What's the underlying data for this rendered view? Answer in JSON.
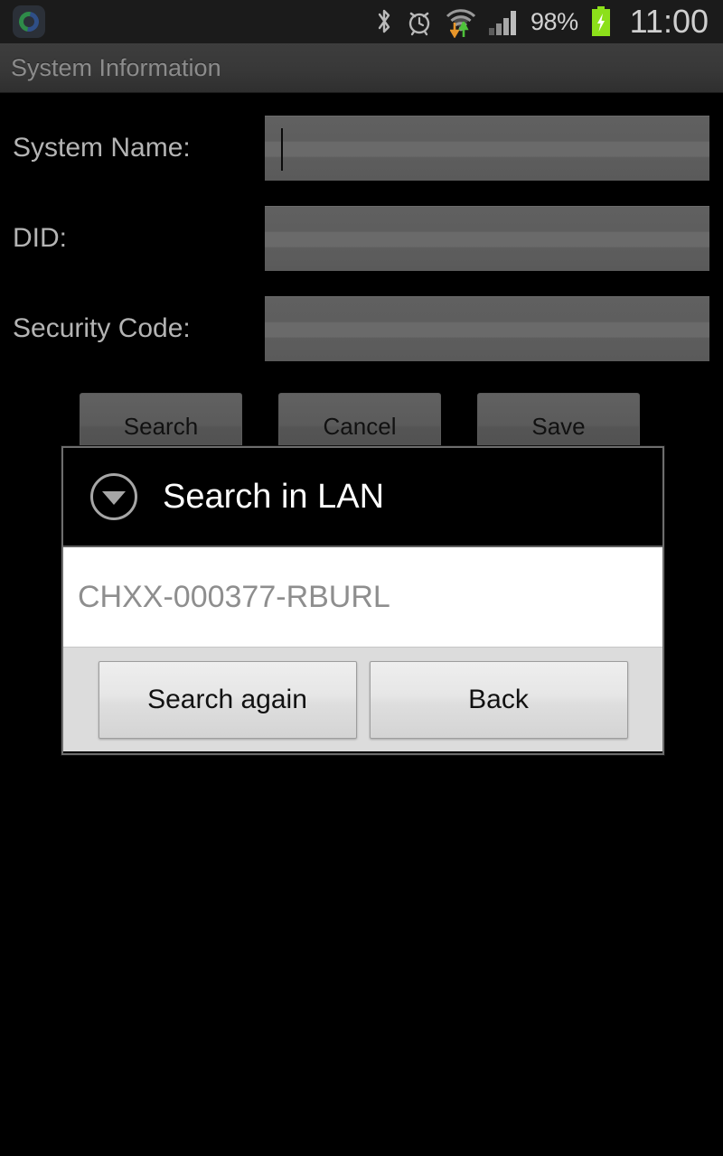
{
  "status_bar": {
    "app_icon": "app-launcher-icon",
    "icons": [
      "bluetooth-icon",
      "alarm-clock-icon",
      "wifi-icon",
      "data-transfer-icon",
      "cellular-signal-icon"
    ],
    "battery_percent": "98%",
    "battery_state": "charging",
    "clock": "11:00",
    "background": "#1b1b1b"
  },
  "action_bar": {
    "title": "System Information"
  },
  "form": {
    "fields": [
      {
        "label": "System Name:",
        "value": "",
        "placeholder": "",
        "focused": true
      },
      {
        "label": "DID:",
        "value": "",
        "placeholder": "",
        "focused": false
      },
      {
        "label": "Security Code:",
        "value": "",
        "placeholder": "",
        "focused": false
      }
    ]
  },
  "buttons": {
    "search": "Search",
    "cancel": "Cancel",
    "save": "Save"
  },
  "dialog": {
    "icon": "chevron-down-circle-icon",
    "title": "Search in LAN",
    "results": [
      {
        "id": "CHXX-000377-RBURL"
      }
    ],
    "footer_buttons": {
      "search_again": "Search again",
      "back": "Back"
    }
  },
  "colors": {
    "screen_background": "#000000",
    "status_bar": "#1b1b1b",
    "action_bar": "#383838",
    "input_field": "#5e5e5e",
    "label_text": "#b4b4b4",
    "dialog_border": "#6d6d6d",
    "dialog_title_text": "#ffffff",
    "list_text": "#8e8e8e",
    "footer_background": "#dcdcdc",
    "battery_green": "#8ce01a"
  }
}
